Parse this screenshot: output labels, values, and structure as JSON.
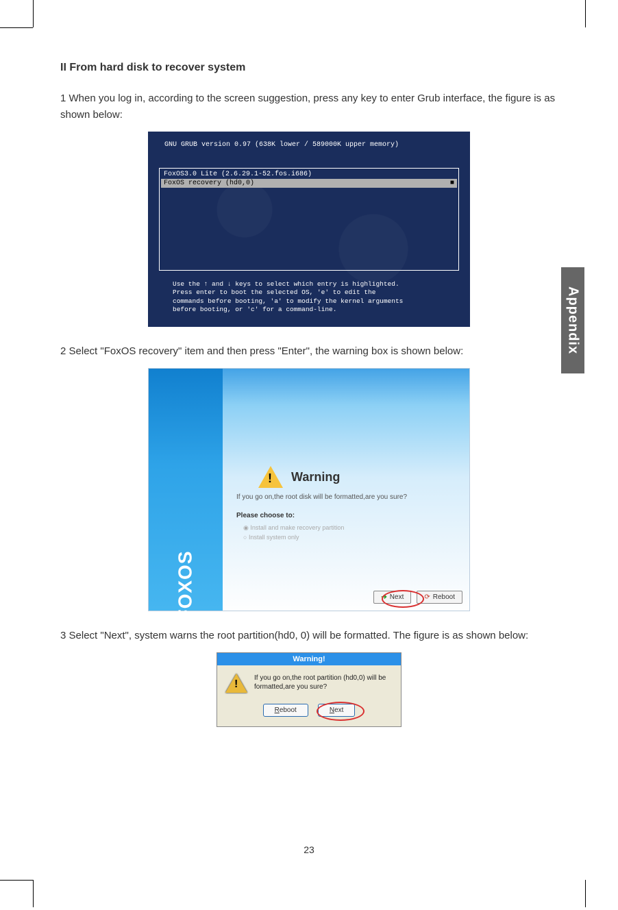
{
  "heading": "II From hard disk to recover system",
  "para1": "1  When you log in, according to the screen suggestion, press any key to enter Grub interface, the figure is as shown below:",
  "para2": "2  Select \"FoxOS  recovery\" item and then press \"Enter\", the warning box is shown below:",
  "para3": "3  Select \"Next\", system warns the root partition(hd0, 0) will be formatted. The figure is as shown below:",
  "sidetab": "Appendix",
  "pagenum": "23",
  "grub": {
    "title": "GNU GRUB  version 0.97  (638K lower / 589000K upper memory)",
    "item1": "FoxOS3.0 Lite (2.6.29.1-52.fos.i686)",
    "item2": "FoxOS recovery (hd0,0)",
    "help": "Use the ↑ and ↓ keys to select which entry is highlighted.\nPress enter to boot the selected OS, 'e' to edit the\ncommands before booting, 'a' to modify the kernel arguments\nbefore booting, or 'c' for a command-line."
  },
  "foxos": {
    "logo": "FOXOS",
    "warn_title": "Warning",
    "warn_sub": "If you go on,the root disk will be formatted,are you sure?",
    "choose_label": "Please choose to:",
    "opt1": "Install and make recovery partition",
    "opt2": "Install system only",
    "next_label": "Next",
    "reboot_label": "Reboot"
  },
  "dlg": {
    "title": "Warning!",
    "msg": "If you go on,the root partition (hd0,0) will be formatted,are you sure?",
    "reboot": "Reboot",
    "next": "Next"
  }
}
